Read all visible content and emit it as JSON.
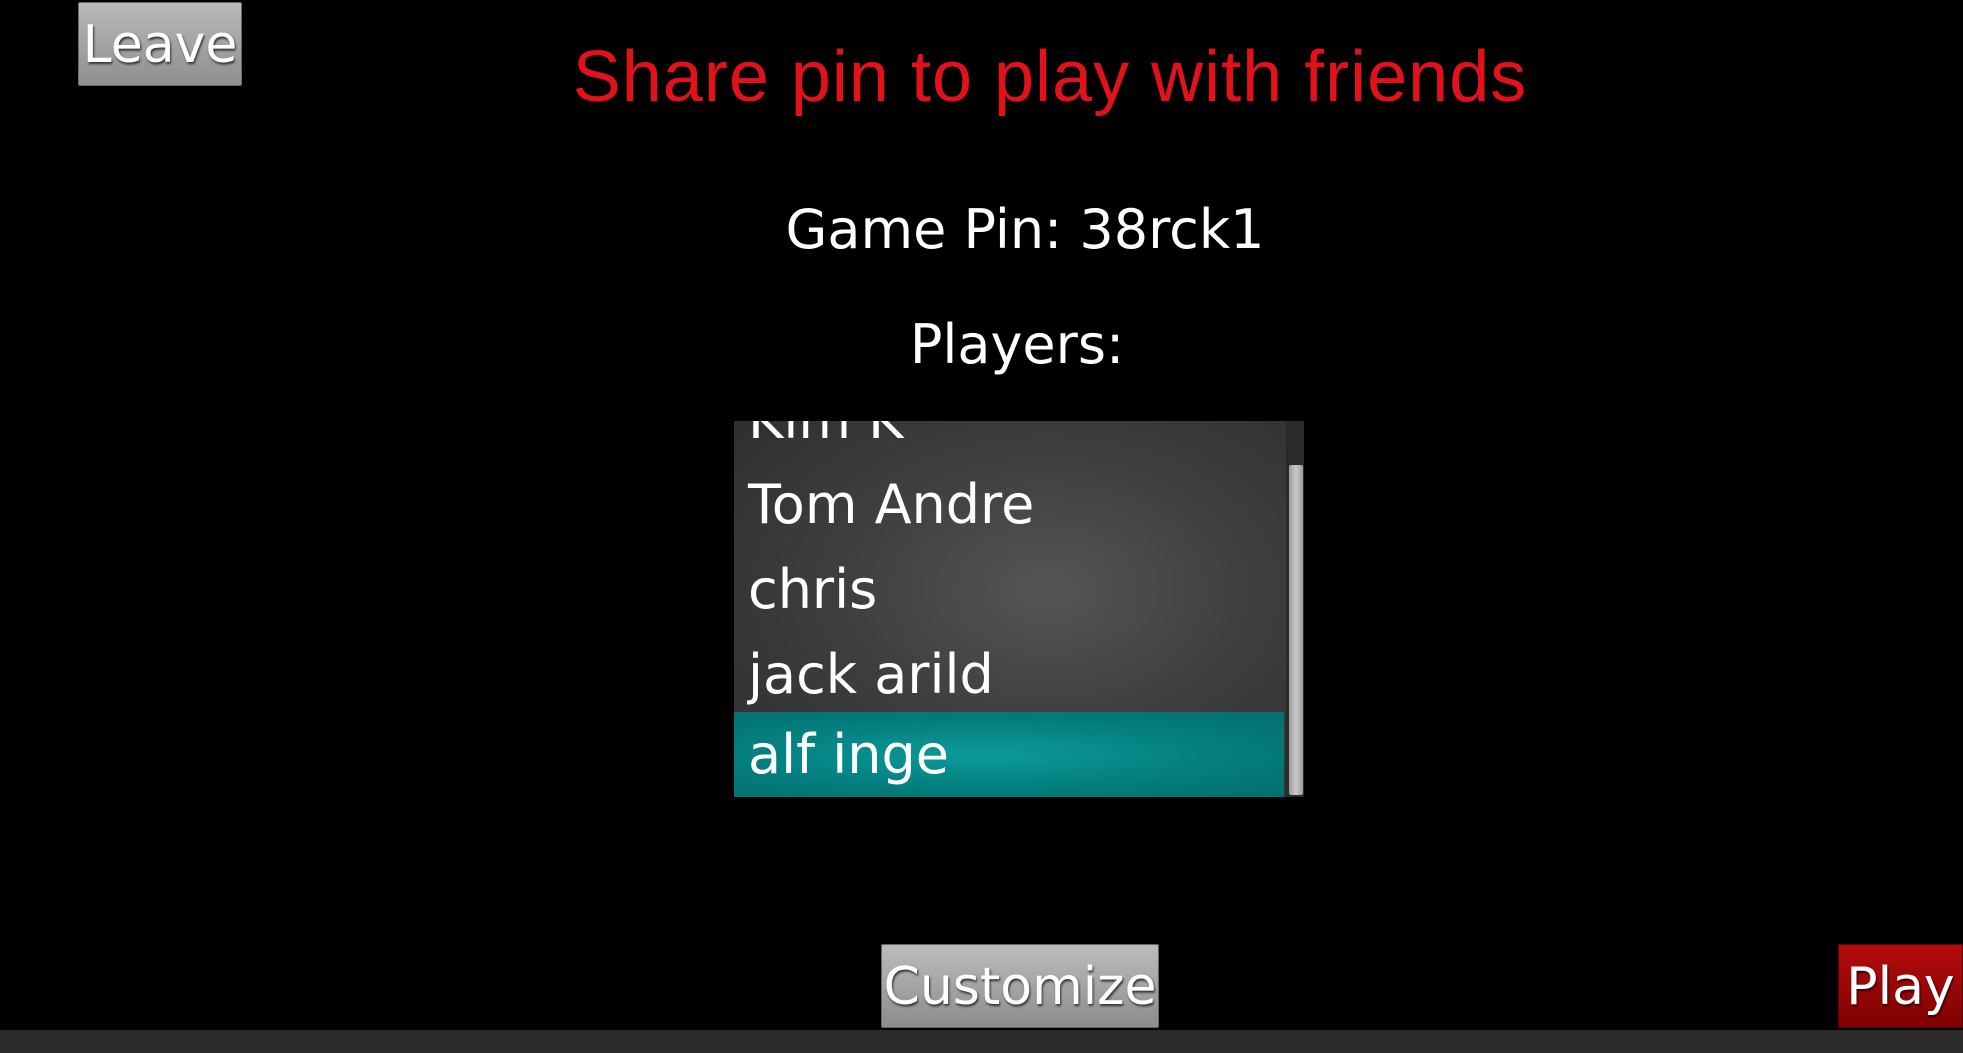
{
  "header": {
    "leave_label": "Leave",
    "banner": "Share pin to play with friends"
  },
  "lobby": {
    "game_pin": "Game Pin: 38rck1",
    "players_label": "Players:",
    "players": [
      "Kim K",
      "Tom Andre",
      "chris",
      "jack arild",
      "alf inge"
    ],
    "selected_player": "alf inge"
  },
  "footer": {
    "customize_label": "Customize",
    "play_label": "Play"
  },
  "colors": {
    "banner": "#e3121a",
    "selected_row": "#047c7c",
    "play_button": "#9a0606",
    "background": "#000000"
  }
}
